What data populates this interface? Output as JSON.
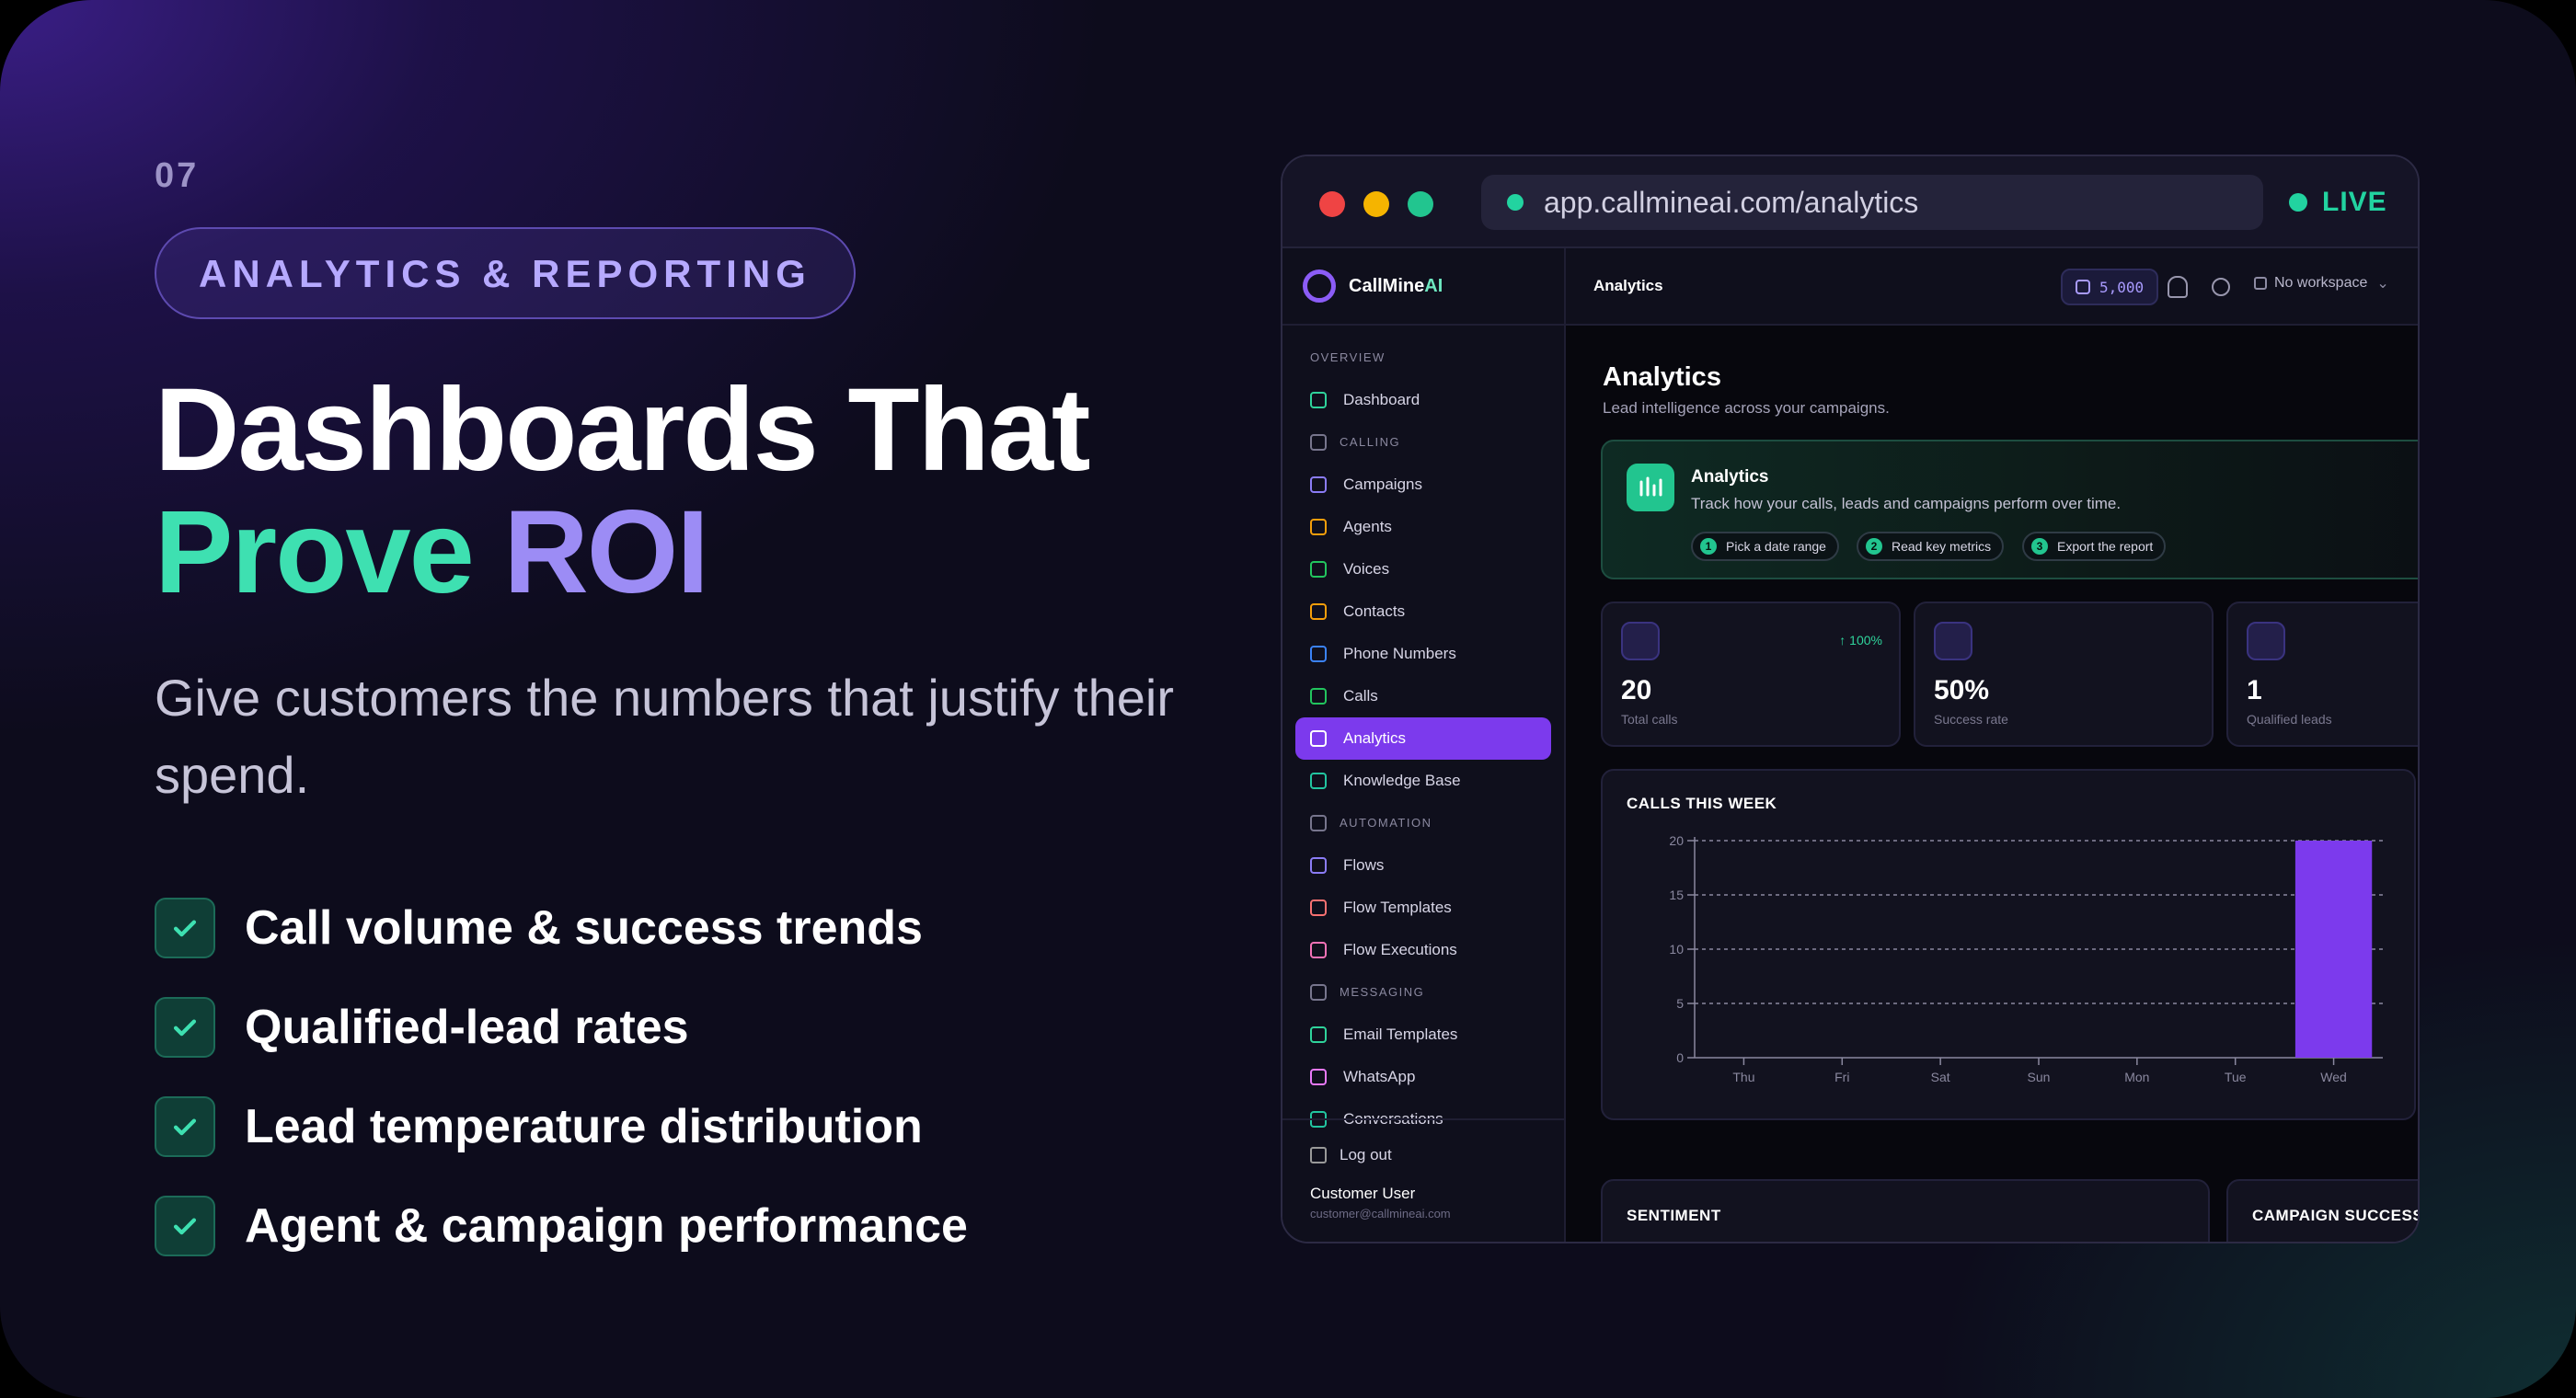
{
  "slide": {
    "number": "07",
    "badge": "ANALYTICS & REPORTING",
    "headline_line1": "Dashboards That",
    "headline_word_a": "Prove",
    "headline_word_b": "ROI",
    "subtitle": "Give customers the numbers that justify their spend.",
    "features": [
      "Call volume & success trends",
      "Qualified-lead rates",
      "Lead temperature distribution",
      "Agent & campaign performance"
    ],
    "colors": {
      "accent_green": "#3ee0b1",
      "accent_purple": "#9c8cf5",
      "check_icon": "check-icon"
    }
  },
  "window": {
    "url": "app.callmineai.com/analytics",
    "live_label": "LIVE",
    "traffic_lights": [
      "#ef4444",
      "#f5b400",
      "#22c58f"
    ]
  },
  "app": {
    "brand_name": "CallMine",
    "brand_suffix": "AI",
    "topbar": {
      "title": "Analytics",
      "credits": "5,000",
      "workspace": "No workspace"
    },
    "sidebar": {
      "overview_label": "OVERVIEW",
      "items": [
        {
          "type": "item",
          "label": "Dashboard",
          "icon": "grid-icon",
          "color": "#2fd39b"
        },
        {
          "type": "section",
          "label": "CALLING",
          "icon": "phone-icon"
        },
        {
          "type": "item",
          "label": "Campaigns",
          "icon": "megaphone-icon",
          "color": "#8b7cf6"
        },
        {
          "type": "item",
          "label": "Agents",
          "icon": "bot-icon",
          "color": "#f59e0b"
        },
        {
          "type": "item",
          "label": "Voices",
          "icon": "waveform-icon",
          "color": "#22c55e"
        },
        {
          "type": "item",
          "label": "Contacts",
          "icon": "contacts-icon",
          "color": "#f59e0b"
        },
        {
          "type": "item",
          "label": "Phone Numbers",
          "icon": "phone-icon",
          "color": "#3b82f6"
        },
        {
          "type": "item",
          "label": "Calls",
          "icon": "phone-call-icon",
          "color": "#22c55e"
        },
        {
          "type": "item",
          "label": "Analytics",
          "icon": "bar-chart-icon",
          "color": "#ffffff",
          "active": true
        },
        {
          "type": "item",
          "label": "Knowledge Base",
          "icon": "book-icon",
          "color": "#22c5a0"
        },
        {
          "type": "section",
          "label": "AUTOMATION",
          "icon": "flow-icon"
        },
        {
          "type": "item",
          "label": "Flows",
          "icon": "flow-icon",
          "color": "#8b7cf6"
        },
        {
          "type": "item",
          "label": "Flow Templates",
          "icon": "template-icon",
          "color": "#f87171"
        },
        {
          "type": "item",
          "label": "Flow Executions",
          "icon": "list-icon",
          "color": "#f472b6"
        },
        {
          "type": "section",
          "label": "MESSAGING",
          "icon": "chat-icon"
        },
        {
          "type": "item",
          "label": "Email Templates",
          "icon": "mail-icon",
          "color": "#2fd39b"
        },
        {
          "type": "item",
          "label": "WhatsApp",
          "icon": "whatsapp-icon",
          "color": "#e879f9"
        },
        {
          "type": "item",
          "label": "Conversations",
          "icon": "chat-icon",
          "color": "#22c5a0"
        }
      ],
      "logout": "Log out",
      "user_name": "Customer User",
      "user_email": "customer@callmineai.com"
    },
    "page": {
      "title": "Analytics",
      "subtitle": "Lead intelligence across your campaigns.",
      "intro": {
        "title": "Analytics",
        "text": "Track how your calls, leads and campaigns perform over time.",
        "steps": [
          {
            "n": "1",
            "label": "Pick a date range"
          },
          {
            "n": "2",
            "label": "Read key metrics"
          },
          {
            "n": "3",
            "label": "Export the report"
          }
        ]
      },
      "stats": [
        {
          "value": "20",
          "label": "Total calls",
          "delta": "↑ 100%",
          "icon": "phone-icon"
        },
        {
          "value": "50%",
          "label": "Success rate",
          "delta": "",
          "icon": "trend-up-icon"
        },
        {
          "value": "1",
          "label": "Qualified leads",
          "delta": "",
          "icon": "target-icon"
        }
      ],
      "bottom_cards": [
        "SENTIMENT",
        "CAMPAIGN SUCCESS"
      ]
    }
  },
  "chart_data": {
    "type": "bar",
    "title": "CALLS THIS WEEK",
    "categories": [
      "Thu",
      "Fri",
      "Sat",
      "Sun",
      "Mon",
      "Tue",
      "Wed"
    ],
    "values": [
      0,
      0,
      0,
      0,
      0,
      0,
      20
    ],
    "yticks": [
      0,
      5,
      10,
      15,
      20
    ],
    "ylim": [
      0,
      20
    ],
    "grid": true,
    "bar_color": "#7c3aed"
  }
}
